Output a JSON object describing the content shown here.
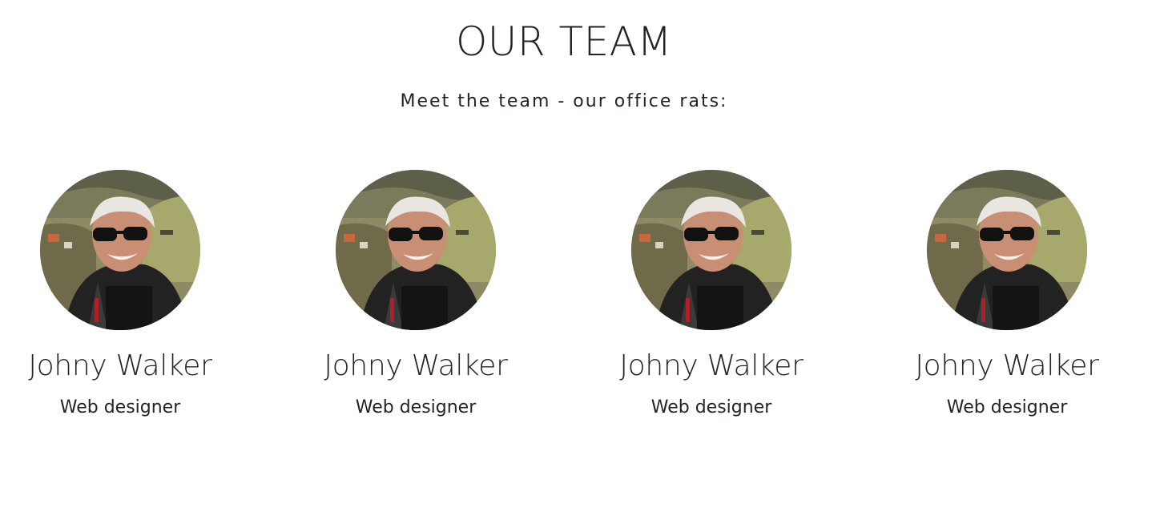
{
  "header": {
    "title": "OUR TEAM",
    "subtitle": "Meet the team - our office rats:"
  },
  "team": [
    {
      "name": "Johny Walker",
      "role": "Web designer",
      "photo": "portrait-photo"
    },
    {
      "name": "Johny Walker",
      "role": "Web designer",
      "photo": "portrait-photo"
    },
    {
      "name": "Johny Walker",
      "role": "Web designer",
      "photo": "portrait-photo"
    },
    {
      "name": "Johny Walker",
      "role": "Web designer",
      "photo": "portrait-photo"
    }
  ],
  "colors": {
    "text": "#212529",
    "background": "#ffffff"
  }
}
